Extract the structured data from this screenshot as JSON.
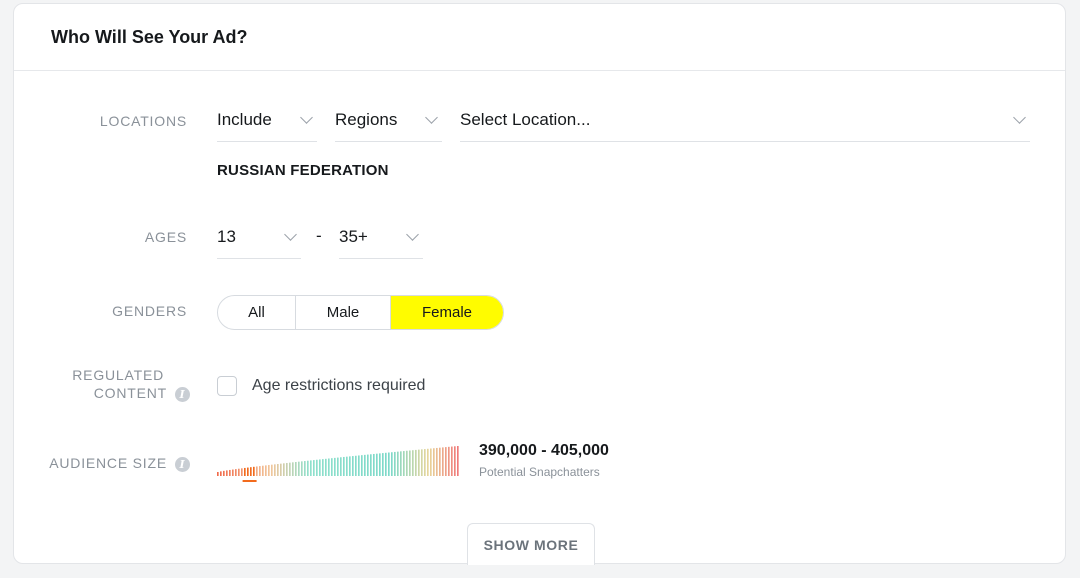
{
  "header": {
    "title": "Who Will See Your Ad?"
  },
  "locations": {
    "label": "LOCATIONS",
    "mode": "Include",
    "type": "Regions",
    "placeholder": "Select Location...",
    "selected": "RUSSIAN FEDERATION"
  },
  "ages": {
    "label": "AGES",
    "min": "13",
    "separator": "-",
    "max": "35+"
  },
  "genders": {
    "label": "GENDERS",
    "options": [
      "All",
      "Male",
      "Female"
    ],
    "selected": "Female",
    "active_color": "#fffc00"
  },
  "regulated": {
    "label_line1": "REGULATED",
    "label_line2": "CONTENT",
    "info_icon": "i",
    "checkbox_label": "Age restrictions required",
    "checked": false
  },
  "audience": {
    "label": "AUDIENCE SIZE",
    "info_icon": "i",
    "range": "390,000 - 405,000",
    "caption": "Potential Snapchatters",
    "meter_position": 0.13
  },
  "show_more": "SHOW MORE",
  "icons": {
    "select_chevron": "chevron-down-icon",
    "info": "info-icon"
  }
}
